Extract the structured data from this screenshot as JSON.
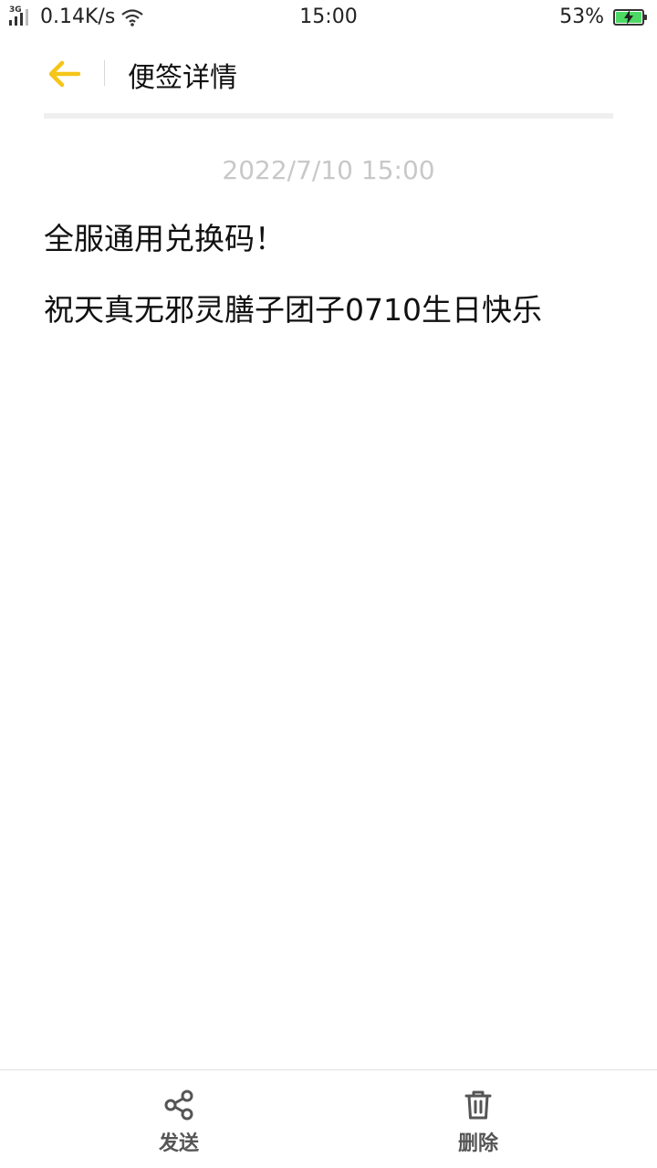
{
  "status_bar": {
    "network_type": "3G",
    "speed": "0.14K/s",
    "time": "15:00",
    "battery": "53%",
    "icons": [
      "signal-icon",
      "wifi-icon",
      "battery-icon"
    ]
  },
  "header": {
    "title": "便签详情",
    "back_icon": "arrow-left-icon",
    "accent_color": "#f5c518"
  },
  "note": {
    "date": "2022/7/10 15:00",
    "lines": [
      "全服通用兑换码！",
      "祝天真无邪灵膳子团子0710生日快乐"
    ]
  },
  "bottom_bar": {
    "send_label": "发送",
    "send_icon": "share-icon",
    "delete_label": "删除",
    "delete_icon": "trash-icon"
  }
}
